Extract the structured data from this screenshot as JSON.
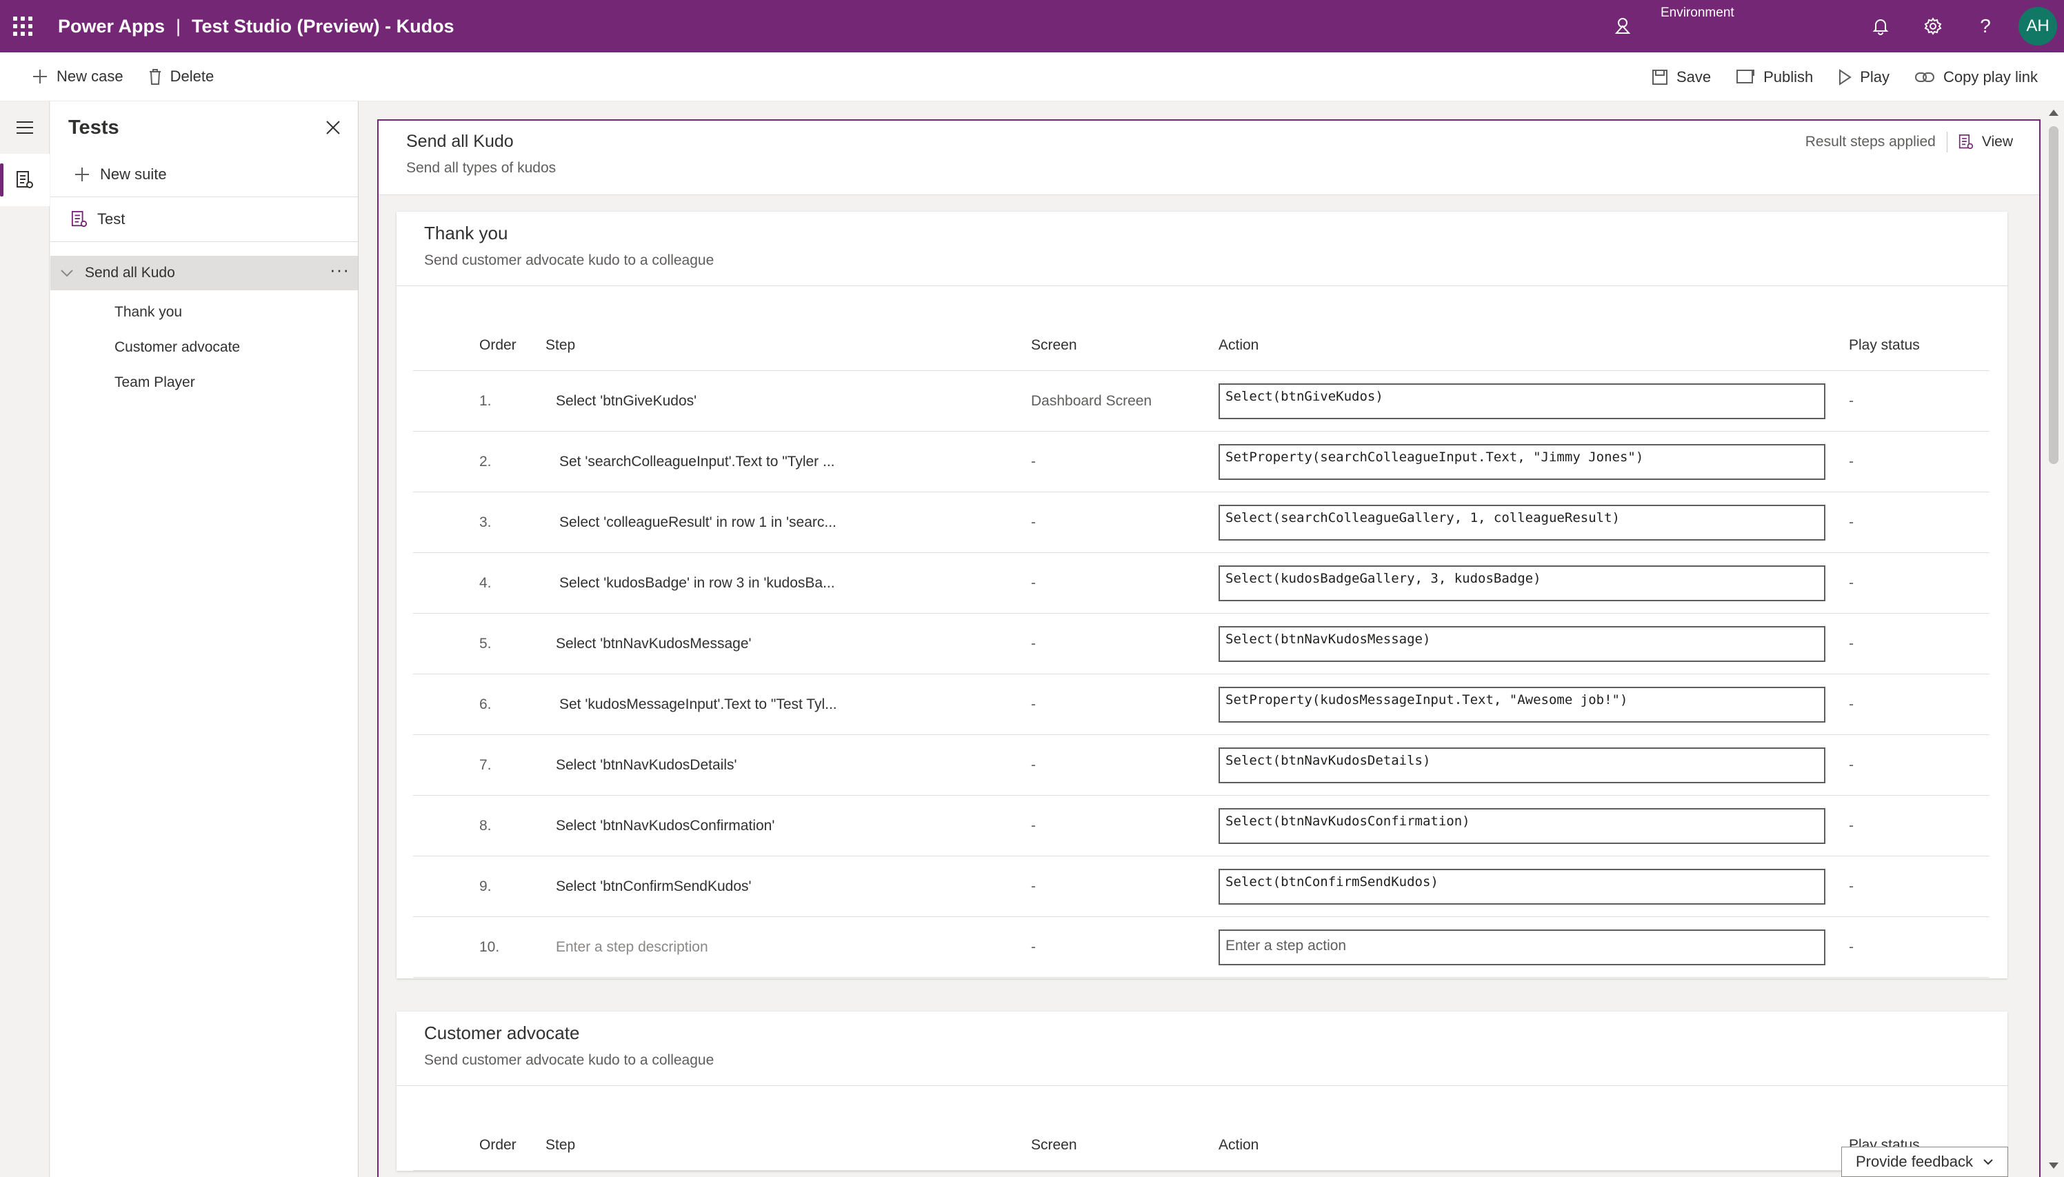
{
  "header": {
    "app_name": "Power Apps",
    "separator": "|",
    "title": "Test Studio (Preview) - Kudos",
    "environment_label": "Environment",
    "avatar_initials": "AH",
    "brand_color": "#742774"
  },
  "toolbar": {
    "new_case": "New case",
    "delete": "Delete",
    "save": "Save",
    "publish": "Publish",
    "play": "Play",
    "copy_play_link": "Copy play link"
  },
  "tests_panel": {
    "title": "Tests",
    "new_suite": "New suite",
    "test_label": "Test",
    "suite": {
      "name": "Send all Kudo",
      "more": "···",
      "cases": [
        "Thank you",
        "Customer advocate",
        "Team Player"
      ]
    }
  },
  "suite": {
    "title": "Send all Kudo",
    "description": "Send all types of kudos",
    "result_steps": "Result steps applied",
    "view": "View"
  },
  "columns": {
    "order": "Order",
    "step": "Step",
    "screen": "Screen",
    "action": "Action",
    "play_status": "Play status"
  },
  "cases": [
    {
      "title": "Thank you",
      "description": "Send customer advocate kudo to a colleague",
      "rows": [
        {
          "order": "1.",
          "step": "Select 'btnGiveKudos'",
          "screen": "Dashboard Screen",
          "action": "Select(btnGiveKudos)",
          "status": "-"
        },
        {
          "order": "2.",
          "step": "Set 'searchColleagueInput'.Text to \"Tyler ...",
          "screen": "-",
          "action": "SetProperty(searchColleagueInput.Text, \"Jimmy Jones\")",
          "status": "-"
        },
        {
          "order": "3.",
          "step": "Select 'colleagueResult' in row 1 in 'searc...",
          "screen": "-",
          "action": "Select(searchColleagueGallery, 1, colleagueResult)",
          "status": "-"
        },
        {
          "order": "4.",
          "step": "Select 'kudosBadge' in row 3 in 'kudosBa...",
          "screen": "-",
          "action": "Select(kudosBadgeGallery, 3, kudosBadge)",
          "status": "-"
        },
        {
          "order": "5.",
          "step": "Select 'btnNavKudosMessage'",
          "screen": "-",
          "action": "Select(btnNavKudosMessage)",
          "status": "-"
        },
        {
          "order": "6.",
          "step": "Set 'kudosMessageInput'.Text to \"Test Tyl...",
          "screen": "-",
          "action": "SetProperty(kudosMessageInput.Text, \"Awesome job!\")",
          "status": "-"
        },
        {
          "order": "7.",
          "step": "Select 'btnNavKudosDetails'",
          "screen": "-",
          "action": "Select(btnNavKudosDetails)",
          "status": "-"
        },
        {
          "order": "8.",
          "step": "Select 'btnNavKudosConfirmation'",
          "screen": "-",
          "action": "Select(btnNavKudosConfirmation)",
          "status": "-"
        },
        {
          "order": "9.",
          "step": "Select 'btnConfirmSendKudos'",
          "screen": "-",
          "action": "Select(btnConfirmSendKudos)",
          "status": "-"
        }
      ],
      "new_row": {
        "order": "10.",
        "step_placeholder": "Enter a step description",
        "screen": "-",
        "action_placeholder": "Enter a step action",
        "status": "-"
      }
    },
    {
      "title": "Customer advocate",
      "description": "Send customer advocate kudo to a colleague"
    }
  ],
  "feedback": {
    "label": "Provide feedback"
  }
}
